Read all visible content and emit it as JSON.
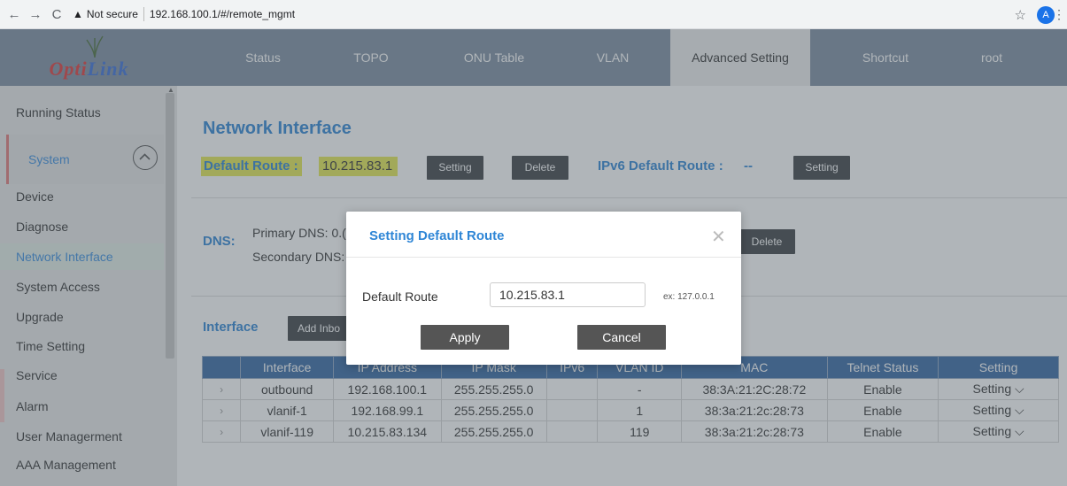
{
  "browser": {
    "back": "←",
    "forward": "→",
    "reload": "C",
    "security": "Not secure",
    "url": "192.168.100.1/#/remote_mgmt",
    "star": "☆",
    "avatar": "A",
    "menu": "⋮"
  },
  "header": {
    "logo": {
      "text_red": "Opti",
      "text_blue": "Link"
    },
    "nav": [
      {
        "label": "Status"
      },
      {
        "label": "TOPO"
      },
      {
        "label": "ONU Table"
      },
      {
        "label": "VLAN"
      },
      {
        "label": "Advanced Setting"
      },
      {
        "label": "Shortcut"
      },
      {
        "label": "root"
      }
    ]
  },
  "sidebar": {
    "running_status": "Running Status",
    "system": "System",
    "items": [
      {
        "label": "Device"
      },
      {
        "label": "Diagnose"
      },
      {
        "label": "Network Interface"
      },
      {
        "label": "System Access"
      },
      {
        "label": "Upgrade"
      },
      {
        "label": "Time Setting"
      },
      {
        "label": "Service"
      },
      {
        "label": "Alarm"
      },
      {
        "label": "User Managerment"
      },
      {
        "label": "AAA Management"
      }
    ]
  },
  "main": {
    "title": "Network Interface",
    "default_route_label": "Default Route :",
    "default_route_value": "10.215.83.1",
    "setting_btn": "Setting",
    "delete_btn": "Delete",
    "ipv6_label": "IPv6 Default Route :",
    "ipv6_value": "--",
    "ipv6_setting_btn": "Setting",
    "dns_label": "DNS:",
    "primary_dns": "Primary DNS: 0.(",
    "secondary_dns": "Secondary DNS:",
    "dns_delete_btn": "Delete",
    "interface_label": "Interface",
    "add_inbound_btn": "Add Inbo"
  },
  "table": {
    "headers": [
      "",
      "Interface",
      "IP Address",
      "IP Mask",
      "IPv6",
      "VLAN ID",
      "MAC",
      "Telnet Status",
      "Setting"
    ],
    "rows": [
      [
        "›",
        "outbound",
        "192.168.100.1",
        "255.255.255.0",
        "",
        "-",
        "38:3A:21:2C:28:72",
        "Enable",
        "Setting ⌵"
      ],
      [
        "›",
        "vlanif-1",
        "192.168.99.1",
        "255.255.255.0",
        "",
        "1",
        "38:3a:21:2c:28:73",
        "Enable",
        "Setting ⌵"
      ],
      [
        "›",
        "vlanif-119",
        "10.215.83.134",
        "255.255.255.0",
        "",
        "119",
        "38:3a:21:2c:28:73",
        "Enable",
        "Setting ⌵"
      ]
    ]
  },
  "modal": {
    "title": "Setting Default Route",
    "close": "✕",
    "field_label": "Default Route",
    "field_value": "10.215.83.1",
    "hint": "ex: 127.0.0.1",
    "apply": "Apply",
    "cancel": "Cancel"
  }
}
